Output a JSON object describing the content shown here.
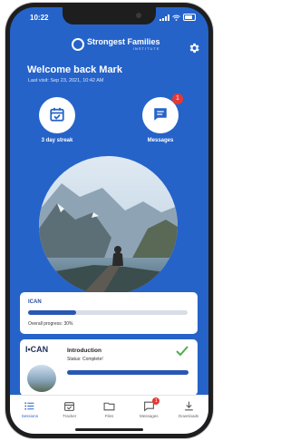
{
  "status_bar": {
    "time": "10:22"
  },
  "brand": {
    "name": "Strongest Families",
    "sub": "INSTITUTE"
  },
  "welcome": {
    "title": "Welcome back Mark",
    "last_visit": "Last visit: Sep 23, 2021, 10:42 AM"
  },
  "quick_actions": {
    "streak_label": "3 day streak",
    "messages_label": "Messages",
    "messages_badge": "1"
  },
  "program_card": {
    "title": "ICAN",
    "progress_label": "Overall progress: 30%",
    "progress": 0.3
  },
  "module_card": {
    "logo_text": "I•CAN",
    "title": "Introduction",
    "status": "Status: Complete!",
    "progress": 1.0
  },
  "tabbar": {
    "items": [
      {
        "label": "Sessions",
        "icon": "sessions-icon"
      },
      {
        "label": "Tracker",
        "icon": "calendar-icon"
      },
      {
        "label": "Files",
        "icon": "folder-icon"
      },
      {
        "label": "Messages",
        "icon": "message-icon",
        "badge": "1"
      },
      {
        "label": "Downloads",
        "icon": "download-icon"
      }
    ]
  },
  "colors": {
    "primary": "#2563c9",
    "badge": "#e53935",
    "check": "#4caf50"
  }
}
